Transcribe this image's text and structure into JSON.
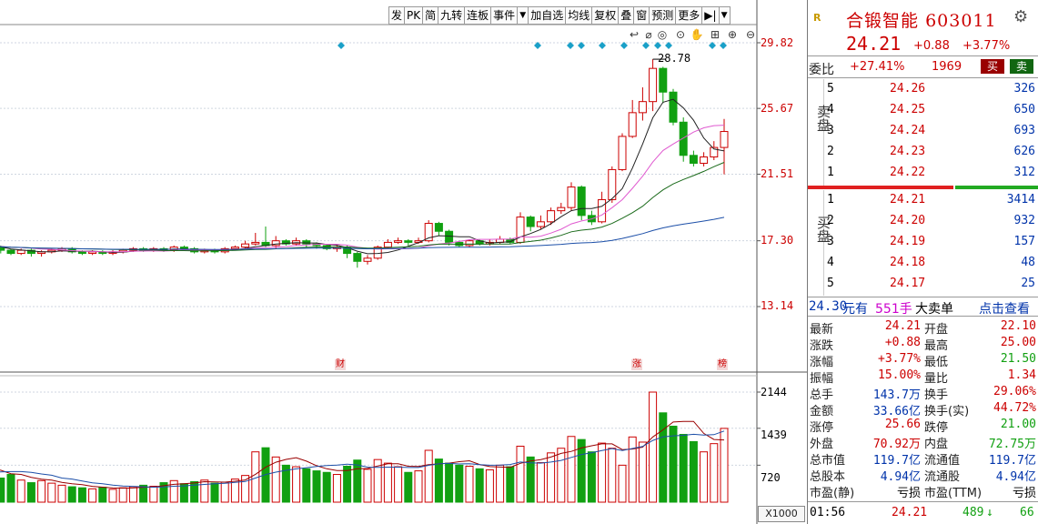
{
  "toolbar": {
    "buttons": [
      "发",
      "PK",
      "简",
      "九转",
      "连板",
      "事件",
      "加自选",
      "均线",
      "复权",
      "叠",
      "窗",
      "预测",
      "更多"
    ]
  },
  "chart": {
    "price_labels": [
      "29.82",
      "25.67",
      "21.51",
      "17.30",
      "13.14"
    ],
    "max_annotation": "28.78",
    "volume_labels": [
      "2144",
      "1439",
      "720"
    ],
    "volume_unit": "X1000",
    "tags": [
      "财",
      "涨",
      "榜"
    ]
  },
  "chart_data": {
    "type": "candlestick",
    "price_axis": [
      13.14,
      17.3,
      21.51,
      25.67,
      29.82
    ],
    "volume_axis": [
      720,
      1439,
      2144
    ],
    "max_price_marked": 28.78,
    "up_color": "#cc0000",
    "down_color": "#11a011",
    "candles": [
      {
        "o": 16.9,
        "c": 16.8,
        "h": 17.0,
        "l": 16.7,
        "v": 560
      },
      {
        "o": 16.8,
        "c": 17.0,
        "h": 17.1,
        "l": 16.6,
        "v": 480
      },
      {
        "o": 17.0,
        "c": 16.9,
        "h": 17.1,
        "l": 16.7,
        "v": 430
      },
      {
        "o": 16.9,
        "c": 16.9,
        "h": 17.0,
        "l": 16.8,
        "v": 520
      },
      {
        "o": 16.9,
        "c": 17.1,
        "h": 17.2,
        "l": 16.8,
        "v": 740
      },
      {
        "o": 17.1,
        "c": 16.9,
        "h": 17.2,
        "l": 16.7,
        "v": 610
      },
      {
        "o": 16.9,
        "c": 17.2,
        "h": 17.3,
        "l": 16.8,
        "v": 880
      },
      {
        "o": 17.2,
        "c": 17.0,
        "h": 17.3,
        "l": 16.9,
        "v": 500
      },
      {
        "o": 17.0,
        "c": 16.8,
        "h": 17.1,
        "l": 16.7,
        "v": 660
      },
      {
        "o": 16.8,
        "c": 16.9,
        "h": 17.0,
        "l": 16.6,
        "v": 600
      },
      {
        "o": 16.9,
        "c": 16.7,
        "h": 17.0,
        "l": 16.5,
        "v": 470
      },
      {
        "o": 16.7,
        "c": 16.5,
        "h": 16.8,
        "l": 16.4,
        "v": 540
      },
      {
        "o": 16.5,
        "c": 16.7,
        "h": 16.8,
        "l": 16.4,
        "v": 430
      },
      {
        "o": 16.7,
        "c": 16.5,
        "h": 16.8,
        "l": 16.3,
        "v": 380
      },
      {
        "o": 16.5,
        "c": 16.6,
        "h": 16.7,
        "l": 16.3,
        "v": 420
      },
      {
        "o": 16.6,
        "c": 16.7,
        "h": 16.8,
        "l": 16.5,
        "v": 370
      },
      {
        "o": 16.7,
        "c": 16.8,
        "h": 16.9,
        "l": 16.6,
        "v": 330
      },
      {
        "o": 16.8,
        "c": 16.6,
        "h": 16.9,
        "l": 16.5,
        "v": 300
      },
      {
        "o": 16.6,
        "c": 16.5,
        "h": 16.7,
        "l": 16.4,
        "v": 280
      },
      {
        "o": 16.5,
        "c": 16.6,
        "h": 16.7,
        "l": 16.4,
        "v": 260
      },
      {
        "o": 16.6,
        "c": 16.5,
        "h": 16.7,
        "l": 16.4,
        "v": 290
      },
      {
        "o": 16.5,
        "c": 16.6,
        "h": 16.7,
        "l": 16.4,
        "v": 250
      },
      {
        "o": 16.6,
        "c": 16.7,
        "h": 16.8,
        "l": 16.5,
        "v": 280
      },
      {
        "o": 16.7,
        "c": 16.8,
        "h": 16.9,
        "l": 16.6,
        "v": 300
      },
      {
        "o": 16.8,
        "c": 16.7,
        "h": 16.9,
        "l": 16.6,
        "v": 330
      },
      {
        "o": 16.7,
        "c": 16.8,
        "h": 16.9,
        "l": 16.6,
        "v": 310
      },
      {
        "o": 16.8,
        "c": 16.7,
        "h": 16.9,
        "l": 16.6,
        "v": 380
      },
      {
        "o": 16.7,
        "c": 16.9,
        "h": 17.0,
        "l": 16.6,
        "v": 420
      },
      {
        "o": 16.9,
        "c": 16.8,
        "h": 17.0,
        "l": 16.7,
        "v": 360
      },
      {
        "o": 16.8,
        "c": 16.6,
        "h": 16.9,
        "l": 16.5,
        "v": 400
      },
      {
        "o": 16.6,
        "c": 16.7,
        "h": 16.8,
        "l": 16.5,
        "v": 430
      },
      {
        "o": 16.7,
        "c": 16.6,
        "h": 16.8,
        "l": 16.5,
        "v": 370
      },
      {
        "o": 16.6,
        "c": 16.8,
        "h": 16.9,
        "l": 16.5,
        "v": 390
      },
      {
        "o": 16.8,
        "c": 16.9,
        "h": 17.0,
        "l": 16.7,
        "v": 450
      },
      {
        "o": 16.9,
        "c": 17.1,
        "h": 17.3,
        "l": 16.8,
        "v": 520
      },
      {
        "o": 17.1,
        "c": 17.2,
        "h": 17.8,
        "l": 17.0,
        "v": 980
      },
      {
        "o": 17.2,
        "c": 17.0,
        "h": 18.2,
        "l": 16.9,
        "v": 1060
      },
      {
        "o": 17.0,
        "c": 17.3,
        "h": 17.6,
        "l": 16.8,
        "v": 880
      },
      {
        "o": 17.3,
        "c": 17.1,
        "h": 17.4,
        "l": 17.0,
        "v": 720
      },
      {
        "o": 17.1,
        "c": 17.3,
        "h": 17.5,
        "l": 17.0,
        "v": 690
      },
      {
        "o": 17.3,
        "c": 17.1,
        "h": 17.4,
        "l": 16.9,
        "v": 650
      },
      {
        "o": 17.1,
        "c": 17.0,
        "h": 17.2,
        "l": 16.8,
        "v": 610
      },
      {
        "o": 17.0,
        "c": 16.8,
        "h": 17.1,
        "l": 16.7,
        "v": 580
      },
      {
        "o": 16.8,
        "c": 16.9,
        "h": 17.0,
        "l": 16.6,
        "v": 540
      },
      {
        "o": 16.9,
        "c": 16.5,
        "h": 17.0,
        "l": 16.2,
        "v": 700
      },
      {
        "o": 16.5,
        "c": 16.0,
        "h": 16.6,
        "l": 15.6,
        "v": 820
      },
      {
        "o": 16.0,
        "c": 16.2,
        "h": 16.4,
        "l": 15.8,
        "v": 640
      },
      {
        "o": 16.2,
        "c": 16.9,
        "h": 17.0,
        "l": 16.1,
        "v": 830
      },
      {
        "o": 16.9,
        "c": 17.2,
        "h": 17.4,
        "l": 16.8,
        "v": 760
      },
      {
        "o": 17.2,
        "c": 17.3,
        "h": 17.5,
        "l": 17.1,
        "v": 690
      },
      {
        "o": 17.3,
        "c": 17.2,
        "h": 17.4,
        "l": 17.0,
        "v": 580
      },
      {
        "o": 17.2,
        "c": 17.3,
        "h": 17.5,
        "l": 17.1,
        "v": 610
      },
      {
        "o": 17.3,
        "c": 18.4,
        "h": 18.6,
        "l": 17.2,
        "v": 1010
      },
      {
        "o": 18.4,
        "c": 17.9,
        "h": 18.5,
        "l": 17.6,
        "v": 840
      },
      {
        "o": 17.9,
        "c": 17.2,
        "h": 18.0,
        "l": 17.0,
        "v": 760
      },
      {
        "o": 17.2,
        "c": 17.0,
        "h": 17.3,
        "l": 16.9,
        "v": 720
      },
      {
        "o": 17.0,
        "c": 17.3,
        "h": 17.4,
        "l": 16.9,
        "v": 700
      },
      {
        "o": 17.3,
        "c": 17.1,
        "h": 17.4,
        "l": 17.0,
        "v": 650
      },
      {
        "o": 17.1,
        "c": 17.2,
        "h": 17.4,
        "l": 17.0,
        "v": 630
      },
      {
        "o": 17.2,
        "c": 17.4,
        "h": 17.6,
        "l": 17.1,
        "v": 720
      },
      {
        "o": 17.4,
        "c": 17.2,
        "h": 17.5,
        "l": 17.1,
        "v": 690
      },
      {
        "o": 17.2,
        "c": 18.8,
        "h": 19.1,
        "l": 17.1,
        "v": 1090
      },
      {
        "o": 18.8,
        "c": 18.2,
        "h": 18.9,
        "l": 17.9,
        "v": 880
      },
      {
        "o": 18.2,
        "c": 18.5,
        "h": 18.9,
        "l": 18.0,
        "v": 770
      },
      {
        "o": 18.5,
        "c": 19.2,
        "h": 19.4,
        "l": 18.3,
        "v": 960
      },
      {
        "o": 19.2,
        "c": 19.4,
        "h": 19.7,
        "l": 19.0,
        "v": 1050
      },
      {
        "o": 19.4,
        "c": 20.7,
        "h": 21.0,
        "l": 19.2,
        "v": 1280
      },
      {
        "o": 20.7,
        "c": 18.9,
        "h": 20.8,
        "l": 18.6,
        "v": 1220
      },
      {
        "o": 18.9,
        "c": 18.5,
        "h": 19.2,
        "l": 18.3,
        "v": 980
      },
      {
        "o": 18.5,
        "c": 19.9,
        "h": 20.4,
        "l": 18.4,
        "v": 1150
      },
      {
        "o": 19.9,
        "c": 21.8,
        "h": 22.0,
        "l": 19.7,
        "v": 1050
      },
      {
        "o": 21.8,
        "c": 23.9,
        "h": 24.1,
        "l": 21.7,
        "v": 720
      },
      {
        "o": 23.9,
        "c": 25.4,
        "h": 26.2,
        "l": 23.8,
        "v": 1270
      },
      {
        "o": 25.4,
        "c": 26.1,
        "h": 27.0,
        "l": 24.9,
        "v": 1170
      },
      {
        "o": 26.1,
        "c": 28.2,
        "h": 28.78,
        "l": 25.5,
        "v": 2144
      },
      {
        "o": 28.2,
        "c": 26.7,
        "h": 28.3,
        "l": 26.0,
        "v": 1740
      },
      {
        "o": 26.7,
        "c": 24.8,
        "h": 26.9,
        "l": 24.6,
        "v": 1480
      },
      {
        "o": 24.8,
        "c": 22.7,
        "h": 25.1,
        "l": 22.3,
        "v": 1320
      },
      {
        "o": 22.7,
        "c": 22.2,
        "h": 23.0,
        "l": 22.0,
        "v": 1180
      },
      {
        "o": 22.2,
        "c": 22.6,
        "h": 22.9,
        "l": 22.0,
        "v": 980
      },
      {
        "o": 22.6,
        "c": 23.2,
        "h": 23.6,
        "l": 22.4,
        "v": 1140
      },
      {
        "o": 23.2,
        "c": 24.21,
        "h": 25.0,
        "l": 21.5,
        "v": 1437
      }
    ],
    "ma_lines": [
      "#222222",
      "#e05ad0",
      "#1a6a1a",
      "#1c4fa8"
    ]
  },
  "quote": {
    "r_icon": "R",
    "name": "合锻智能",
    "code": "603011",
    "price": "24.21",
    "change": "+0.88",
    "change_pct": "+3.77%",
    "wei_label": "委比",
    "wei_pct": "+27.41%",
    "wei_diff": "1969",
    "buy_btn": "买",
    "sell_btn": "卖",
    "sell_side_label": "卖盘",
    "buy_side_label": "买盘",
    "asks": [
      {
        "n": "5",
        "p": "24.26",
        "v": "326"
      },
      {
        "n": "4",
        "p": "24.25",
        "v": "650"
      },
      {
        "n": "3",
        "p": "24.24",
        "v": "693"
      },
      {
        "n": "2",
        "p": "24.23",
        "v": "626"
      },
      {
        "n": "1",
        "p": "24.22",
        "v": "312"
      }
    ],
    "bids": [
      {
        "n": "1",
        "p": "24.21",
        "v": "3414"
      },
      {
        "n": "2",
        "p": "24.20",
        "v": "932"
      },
      {
        "n": "3",
        "p": "24.19",
        "v": "157"
      },
      {
        "n": "4",
        "p": "24.18",
        "v": "48"
      },
      {
        "n": "5",
        "p": "24.17",
        "v": "25"
      }
    ],
    "ticker": {
      "price": "24.30",
      "yuan": "元有",
      "qty": "551手",
      "text": "大卖单",
      "link": "点击查看"
    },
    "stats": [
      {
        "l1": "最新",
        "v1": "24.21",
        "c1": "#cc0000",
        "l2": "开盘",
        "v2": "22.10",
        "c2": "#cc0000"
      },
      {
        "l1": "涨跌",
        "v1": "+0.88",
        "c1": "#cc0000",
        "l2": "最高",
        "v2": "25.00",
        "c2": "#cc0000"
      },
      {
        "l1": "涨幅",
        "v1": "+3.77%",
        "c1": "#cc0000",
        "l2": "最低",
        "v2": "21.50",
        "c2": "#11a011"
      },
      {
        "l1": "振幅",
        "v1": "15.00%",
        "c1": "#cc0000",
        "l2": "量比",
        "v2": "1.34",
        "c2": "#cc0000"
      },
      {
        "l1": "总手",
        "v1": "143.7万",
        "c1": "#0033aa",
        "l2": "换手",
        "v2": "29.06%",
        "c2": "#cc0000"
      },
      {
        "l1": "金额",
        "v1": "33.66亿",
        "c1": "#0033aa",
        "l2": "换手(实)",
        "v2": "44.72%",
        "c2": "#cc0000"
      },
      {
        "l1": "涨停",
        "v1": "25.66",
        "c1": "#cc0000",
        "l2": "跌停",
        "v2": "21.00",
        "c2": "#11a011"
      },
      {
        "l1": "外盘",
        "v1": "70.92万",
        "c1": "#cc0000",
        "l2": "内盘",
        "v2": "72.75万",
        "c2": "#11a011"
      },
      {
        "l1": "总市值",
        "v1": "119.7亿",
        "c1": "#0033aa",
        "l2": "流通值",
        "v2": "119.7亿",
        "c2": "#0033aa"
      },
      {
        "l1": "总股本",
        "v1": "4.94亿",
        "c1": "#0033aa",
        "l2": "流通股",
        "v2": "4.94亿",
        "c2": "#0033aa"
      },
      {
        "l1": "市盈(静)",
        "v1": "亏损",
        "c1": "#000000",
        "l2": "市盈(TTM)",
        "v2": "亏损",
        "c2": "#000000"
      }
    ],
    "footer": {
      "time": "01:56",
      "price": "24.21",
      "vol": "489",
      "arrow": "↓",
      "extra": "66"
    }
  }
}
